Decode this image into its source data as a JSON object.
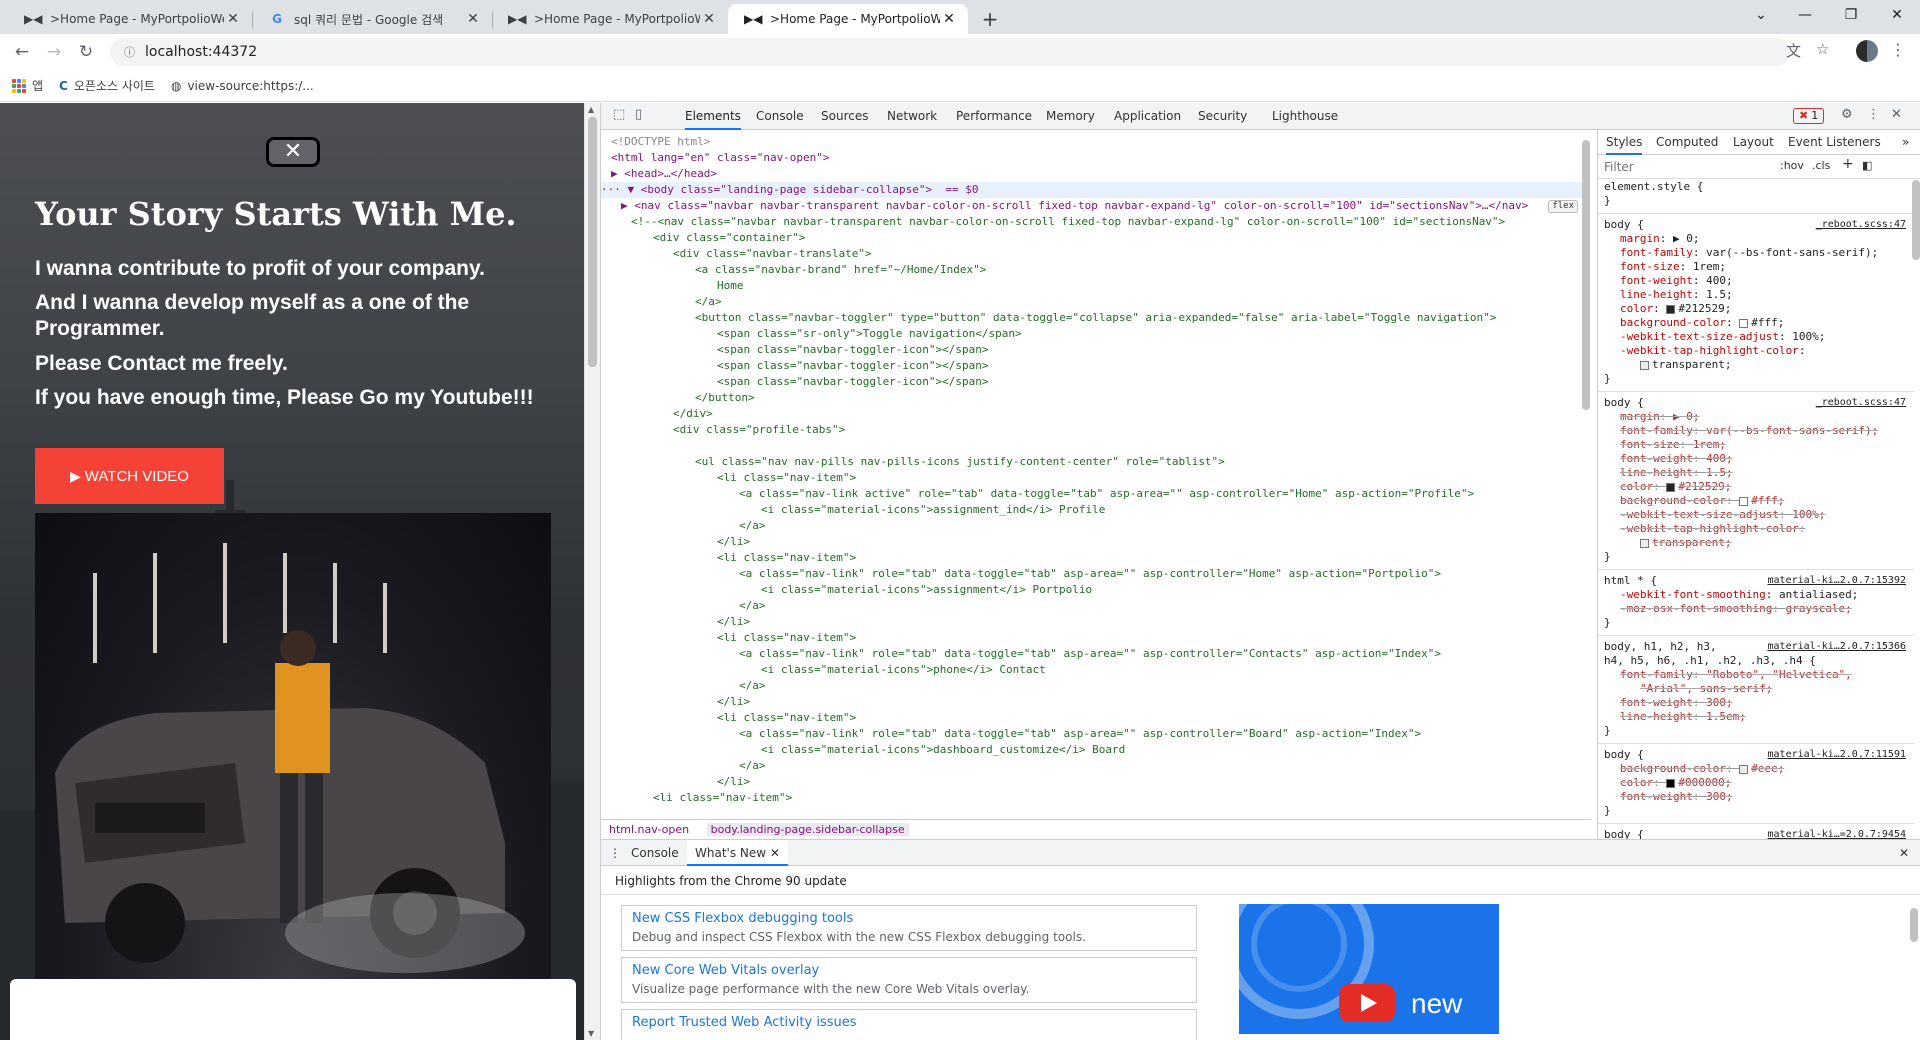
{
  "tabs": [
    {
      "title": ">Home Page - MyPortpolioWel",
      "icon": "▶◀"
    },
    {
      "title": "sql 쿼리 문법 - Google 검색",
      "icon": "G"
    },
    {
      "title": ">Home Page - MyPortpolioWel",
      "icon": "▶◀"
    },
    {
      "title": ">Home Page - MyPortpolioWel",
      "icon": "▶◀"
    }
  ],
  "address_bar": {
    "url": "localhost:44372"
  },
  "bookmarks": [
    {
      "label": "앱"
    },
    {
      "label": "오픈소스 사이트"
    },
    {
      "label": "view-source:https:/..."
    }
  ],
  "webpage": {
    "close_symbol": "✕",
    "hero_title": "Your Story Starts With Me.",
    "lines": [
      "I wanna contribute to profit of your company.",
      "And I wanna develop myself as a one of the Programmer.",
      "Please Contact me freely.",
      "If you have enough time, Please Go my Youtube!!!"
    ],
    "watch_button": "WATCH VIDEO"
  },
  "devtools": {
    "tabs": [
      "Elements",
      "Console",
      "Sources",
      "Network",
      "Performance",
      "Memory",
      "Application",
      "Security",
      "Lighthouse"
    ],
    "error_count": "1",
    "styles_tabs": [
      "Styles",
      "Computed",
      "Layout",
      "Event Listeners"
    ],
    "filter_placeholder": "Filter",
    "filter_hov": ":hov",
    "filter_cls": ".cls",
    "breadcrumbs": [
      "html.nav-open",
      "body.landing-page.sidebar-collapse"
    ],
    "drawer_tabs": [
      "Console",
      "What's New"
    ],
    "highlights": "Highlights from the Chrome 90 update",
    "features": [
      {
        "title": "New CSS Flexbox debugging tools",
        "desc": "Debug and inspect CSS Flexbox with the new CSS Flexbox debugging tools."
      },
      {
        "title": "New Core Web Vitals overlay",
        "desc": "Visualize page performance with the new Core Web Vitals overlay."
      },
      {
        "title": "Report Trusted Web Activity issues",
        "desc": ""
      }
    ],
    "promo_text": "new",
    "flex_badge": "flex",
    "selected_marker": "== $0"
  },
  "code_lines": [
    {
      "indent": 10,
      "text": "<!DOCTYPE html>",
      "kind": "g"
    },
    {
      "indent": 10,
      "text": "<html lang=\"en\" class=\"nav-open\">",
      "kind": "t"
    },
    {
      "indent": 10,
      "text": "▶ <head>…</head>",
      "kind": "t"
    },
    {
      "indent": 0,
      "text": "··· ▼ <body class=\"landing-page sidebar-collapse\">  == $0",
      "kind": "t",
      "selected": true
    },
    {
      "indent": 20,
      "text": "▶ <nav class=\"navbar navbar-transparent navbar-color-on-scroll fixed-top navbar-expand-lg\" color-on-scroll=\"100\" id=\"sectionsNav\">…</nav>",
      "kind": "t"
    },
    {
      "indent": 30,
      "text": "<!--<nav class=\"navbar navbar-transparent navbar-color-on-scroll fixed-top navbar-expand-lg\" color-on-scroll=\"100\" id=\"sectionsNav\">",
      "kind": "c"
    },
    {
      "indent": 52,
      "text": "<div class=\"container\">",
      "kind": "c"
    },
    {
      "indent": 72,
      "text": "<div class=\"navbar-translate\">",
      "kind": "c"
    },
    {
      "indent": 94,
      "text": "<a class=\"navbar-brand\" href=\"~/Home/Index\">",
      "kind": "c"
    },
    {
      "indent": 116,
      "text": "Home",
      "kind": "c"
    },
    {
      "indent": 94,
      "text": "</a>",
      "kind": "c"
    },
    {
      "indent": 94,
      "text": "<button class=\"navbar-toggler\" type=\"button\" data-toggle=\"collapse\" aria-expanded=\"false\" aria-label=\"Toggle navigation\">",
      "kind": "c"
    },
    {
      "indent": 116,
      "text": "<span class=\"sr-only\">Toggle navigation</span>",
      "kind": "c"
    },
    {
      "indent": 116,
      "text": "<span class=\"navbar-toggler-icon\"></span>",
      "kind": "c"
    },
    {
      "indent": 116,
      "text": "<span class=\"navbar-toggler-icon\"></span>",
      "kind": "c"
    },
    {
      "indent": 116,
      "text": "<span class=\"navbar-toggler-icon\"></span>",
      "kind": "c"
    },
    {
      "indent": 94,
      "text": "</button>",
      "kind": "c"
    },
    {
      "indent": 72,
      "text": "</div>",
      "kind": "c"
    },
    {
      "indent": 72,
      "text": "<div class=\"profile-tabs\">",
      "kind": "c"
    },
    {
      "indent": 72,
      "text": "",
      "kind": "c"
    },
    {
      "indent": 94,
      "text": "<ul class=\"nav nav-pills nav-pills-icons justify-content-center\" role=\"tablist\">",
      "kind": "c"
    },
    {
      "indent": 116,
      "text": "<li class=\"nav-item\">",
      "kind": "c"
    },
    {
      "indent": 138,
      "text": "<a class=\"nav-link active\" role=\"tab\" data-toggle=\"tab\" asp-area=\"\" asp-controller=\"Home\" asp-action=\"Profile\">",
      "kind": "c"
    },
    {
      "indent": 160,
      "text": "<i class=\"material-icons\">assignment_ind</i> Profile",
      "kind": "c"
    },
    {
      "indent": 138,
      "text": "</a>",
      "kind": "c"
    },
    {
      "indent": 116,
      "text": "</li>",
      "kind": "c"
    },
    {
      "indent": 116,
      "text": "<li class=\"nav-item\">",
      "kind": "c"
    },
    {
      "indent": 138,
      "text": "<a class=\"nav-link\" role=\"tab\" data-toggle=\"tab\" asp-area=\"\" asp-controller=\"Home\" asp-action=\"Portpolio\">",
      "kind": "c"
    },
    {
      "indent": 160,
      "text": "<i class=\"material-icons\">assignment</i> Portpolio",
      "kind": "c"
    },
    {
      "indent": 138,
      "text": "</a>",
      "kind": "c"
    },
    {
      "indent": 116,
      "text": "</li>",
      "kind": "c"
    },
    {
      "indent": 116,
      "text": "<li class=\"nav-item\">",
      "kind": "c"
    },
    {
      "indent": 138,
      "text": "<a class=\"nav-link\" role=\"tab\" data-toggle=\"tab\" asp-area=\"\" asp-controller=\"Contacts\" asp-action=\"Index\">",
      "kind": "c"
    },
    {
      "indent": 160,
      "text": "<i class=\"material-icons\">phone</i> Contact",
      "kind": "c"
    },
    {
      "indent": 138,
      "text": "</a>",
      "kind": "c"
    },
    {
      "indent": 116,
      "text": "</li>",
      "kind": "c"
    },
    {
      "indent": 116,
      "text": "<li class=\"nav-item\">",
      "kind": "c"
    },
    {
      "indent": 138,
      "text": "<a class=\"nav-link\" role=\"tab\" data-toggle=\"tab\" asp-area=\"\" asp-controller=\"Board\" asp-action=\"Index\">",
      "kind": "c"
    },
    {
      "indent": 160,
      "text": "<i class=\"material-icons\">dashboard_customize</i> Board",
      "kind": "c"
    },
    {
      "indent": 138,
      "text": "</a>",
      "kind": "c"
    },
    {
      "indent": 116,
      "text": "</li>",
      "kind": "c"
    },
    {
      "indent": 52,
      "text": "<li class=\"nav-item\">",
      "kind": "c"
    }
  ],
  "style_rules": [
    {
      "selector": "element.style {",
      "source": "",
      "props": [],
      "close": "}"
    },
    {
      "selector": "body {",
      "source": "_reboot.scss:47",
      "close": "}",
      "props": [
        {
          "n": "margin",
          "v": "▶ 0;"
        },
        {
          "n": "font-family",
          "v": "var(--bs-font-sans-serif);"
        },
        {
          "n": "font-size",
          "v": "1rem;"
        },
        {
          "n": "font-weight",
          "v": "400;"
        },
        {
          "n": "line-height",
          "v": "1.5;"
        },
        {
          "n": "color",
          "v": "#212529;",
          "swatch": "#212529"
        },
        {
          "n": "background-color",
          "v": "#fff;",
          "swatch": "#ffffff"
        },
        {
          "n": "-webkit-text-size-adjust",
          "v": "100%;"
        },
        {
          "n": "-webkit-tap-highlight-color",
          "v": ""
        },
        {
          "n": "",
          "v": "transparent;",
          "swatch": "#eeeeee"
        }
      ]
    },
    {
      "selector": "body {",
      "source": "_reboot.scss:47",
      "close": "}",
      "strike": true,
      "props": [
        {
          "n": "margin",
          "v": "▶ 0;"
        },
        {
          "n": "font-family",
          "v": "var(--bs-font-sans-serif);"
        },
        {
          "n": "font-size",
          "v": "1rem;"
        },
        {
          "n": "font-weight",
          "v": "400;"
        },
        {
          "n": "line-height",
          "v": "1.5;"
        },
        {
          "n": "color",
          "v": "#212529;",
          "swatch": "#212529"
        },
        {
          "n": "background-color",
          "v": "#fff;",
          "swatch": "#ffffff"
        },
        {
          "n": "-webkit-text-size-adjust",
          "v": "100%;"
        },
        {
          "n": "-webkit-tap-highlight-color",
          "v": ""
        },
        {
          "n": "",
          "v": "transparent;",
          "swatch": "#eeeeee"
        }
      ]
    },
    {
      "selector": "html * {",
      "source": "material-ki…2.0.7:15392",
      "close": "}",
      "props": [
        {
          "n": "-webkit-font-smoothing",
          "v": "antialiased;"
        },
        {
          "n": "-moz-osx-font-smoothing",
          "v": "grayscale;",
          "strike": true
        }
      ]
    },
    {
      "selector": "body, h1, h2, h3,",
      "selector2": "h4, h5, h6, .h1, .h2, .h3, .h4 {",
      "source": "material-ki…2.0.7:15366",
      "close": "}",
      "strike": true,
      "props": [
        {
          "n": "font-family",
          "v": "\"Roboto\", \"Helvetica\","
        },
        {
          "n": "",
          "v": "\"Arial\", sans-serif;"
        },
        {
          "n": "font-weight",
          "v": "300;"
        },
        {
          "n": "line-height",
          "v": "1.5em;"
        }
      ]
    },
    {
      "selector": "body {",
      "source": "material-ki…2.0.7:11591",
      "close": "}",
      "strike": true,
      "props": [
        {
          "n": "background-color",
          "v": "#eee;",
          "swatch": "#eeeeee"
        },
        {
          "n": "color",
          "v": "#000000;",
          "swatch": "#000000"
        },
        {
          "n": "font-weight",
          "v": "300;"
        }
      ]
    },
    {
      "selector": "body {",
      "source": "material-ki…=2.0.7:9454",
      "close": "",
      "props": []
    }
  ]
}
